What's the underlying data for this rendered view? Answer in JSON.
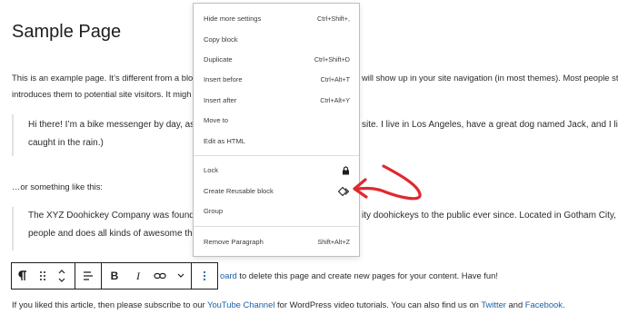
{
  "page": {
    "title": "Sample Page",
    "intro_line1_a": "This is an example page. It’s different from a blog",
    "intro_line1_b": "will show up in your site navigation (in most themes). Most people star",
    "intro_line2": "introduces them to potential site visitors. It migh",
    "quote1_line1_a": "Hi there! I’m a bike messenger by day, as",
    "quote1_line1_b": "site. I live in Los Angeles, have a great dog named Jack, and I li",
    "quote1_line2": "caught in the rain.)",
    "mid_text": "…or something like this:",
    "quote2_line1_a": "The XYZ Doohickey Company was found",
    "quote2_line1_b": "ity doohickeys to the public ever since. Located in Gotham City,",
    "quote2_line2": "people and does all kinds of awesome th",
    "board_link": "oard",
    "board_rest": " to delete this page and create new pages for your content. Have fun!",
    "last_a": "If you liked this article, then please subscribe to our ",
    "last_link1": "YouTube Channel",
    "last_b": " for WordPress video tutorials. You can also find us on ",
    "last_link2": "Twitter",
    "last_c": " and ",
    "last_link3": "Facebook",
    "last_d": "."
  },
  "toolbar": {
    "paragraph_icon": "paragraph-icon",
    "drag_icon": "drag-handle-icon",
    "move_icon": "move-up-down-icon",
    "align_icon": "align-left-icon",
    "bold_label": "B",
    "italic_label": "I",
    "link_icon": "link-icon",
    "more_icon": "chevron-down-icon",
    "options_icon": "vertical-ellipsis-icon"
  },
  "menu": {
    "items": [
      {
        "label": "Hide more settings",
        "shortcut": "Ctrl+Shift+,"
      },
      {
        "label": "Copy block",
        "shortcut": ""
      },
      {
        "label": "Duplicate",
        "shortcut": "Ctrl+Shift+D"
      },
      {
        "label": "Insert before",
        "shortcut": "Ctrl+Alt+T"
      },
      {
        "label": "Insert after",
        "shortcut": "Ctrl+Alt+Y"
      },
      {
        "label": "Move to",
        "shortcut": ""
      },
      {
        "label": "Edit as HTML",
        "shortcut": ""
      },
      {
        "label": "Lock",
        "icon": "lock-icon"
      },
      {
        "label": "Create Reusable block",
        "icon": "reusable-block-icon"
      },
      {
        "label": "Group",
        "shortcut": ""
      },
      {
        "label": "Remove Paragraph",
        "shortcut": "Shift+Alt+Z"
      }
    ]
  },
  "colors": {
    "link": "#1a61a9",
    "annotation_arrow": "#e0282e"
  }
}
